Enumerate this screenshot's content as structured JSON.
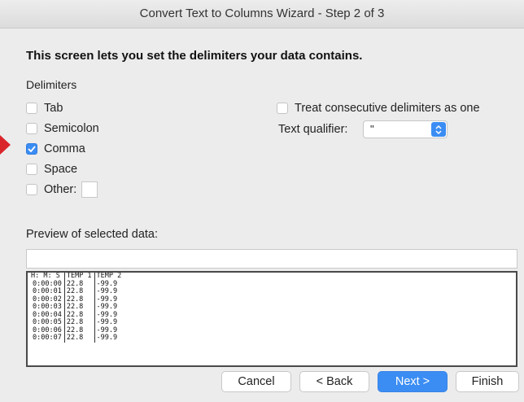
{
  "window": {
    "title": "Convert Text to Columns Wizard - Step 2 of 3"
  },
  "heading": "This screen lets you set the delimiters your data contains.",
  "delimiters": {
    "section_label": "Delimiters",
    "tab": {
      "label": "Tab",
      "checked": false
    },
    "semicolon": {
      "label": "Semicolon",
      "checked": false
    },
    "comma": {
      "label": "Comma",
      "checked": true
    },
    "space": {
      "label": "Space",
      "checked": false
    },
    "other": {
      "label": "Other:",
      "checked": false,
      "value": ""
    }
  },
  "options": {
    "consecutive": {
      "label": "Treat consecutive delimiters as one",
      "checked": false
    },
    "text_qualifier": {
      "label": "Text qualifier:",
      "value": "\""
    }
  },
  "preview": {
    "label": "Preview of selected data:",
    "rows": [
      [
        "H: M: S",
        "TEMP 1",
        "TEMP 2"
      ],
      [
        "0:00:00",
        "22.8",
        "-99.9"
      ],
      [
        "0:00:01",
        "22.8",
        "-99.9"
      ],
      [
        "0:00:02",
        "22.8",
        "-99.9"
      ],
      [
        "0:00:03",
        "22.8",
        "-99.9"
      ],
      [
        "0:00:04",
        "22.8",
        "-99.9"
      ],
      [
        "0:00:05",
        "22.8",
        "-99.9"
      ],
      [
        "0:00:06",
        "22.8",
        "-99.9"
      ],
      [
        "0:00:07",
        "22.8",
        "-99.9"
      ]
    ]
  },
  "buttons": {
    "cancel": "Cancel",
    "back": "< Back",
    "next": "Next >",
    "finish": "Finish"
  },
  "colors": {
    "accent": "#3b8df3",
    "pointer": "#d9252a",
    "background": "#ececec"
  }
}
